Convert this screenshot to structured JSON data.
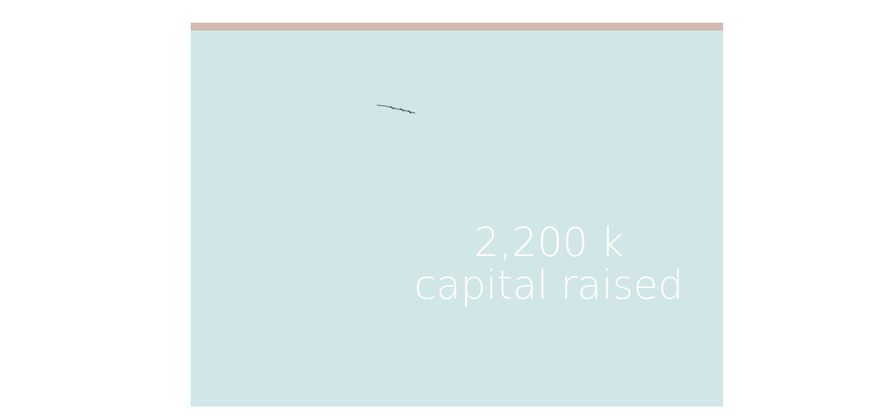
{
  "stat": {
    "value": "2,200 k",
    "label": "capital raised"
  },
  "colors": {
    "background": "#ffffff",
    "card": "#d1e6e7",
    "top_bar": "#d3bbb2",
    "text": "#ffffff",
    "bird": "#4a5358"
  },
  "icons": {
    "bird": "flying-bird-icon"
  }
}
